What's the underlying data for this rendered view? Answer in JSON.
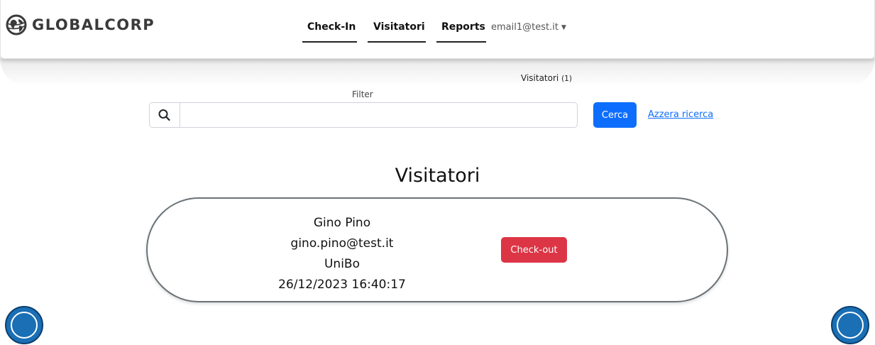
{
  "brand": {
    "name": "GLOBALCORP",
    "logo_icon": "globe-icon",
    "color": "#3a3a3a"
  },
  "nav": {
    "links": [
      {
        "label": "Check-In"
      },
      {
        "label": "Visitatori"
      },
      {
        "label": "Reports"
      }
    ],
    "user_email": "email1@test.it",
    "user_menu_icon": "caret-down-icon"
  },
  "summary": {
    "label": "Visitatori",
    "count": "(1)"
  },
  "search": {
    "label": "Filter",
    "value": "",
    "icon": "search-icon",
    "button_label": "Cerca",
    "reset_label": "Azzera ricerca"
  },
  "page": {
    "title": "Visitatori"
  },
  "visitors": [
    {
      "name": "Gino Pino",
      "email": "gino.pino@test.it",
      "company": "UniBo",
      "checkin_time": "26/12/2023 16:40:17",
      "action_label": "Check-out"
    }
  ],
  "colors": {
    "primary": "#0d6efd",
    "danger": "#dc3545",
    "card_border": "#6b7378",
    "corner_icon": "#1a6fb5"
  }
}
